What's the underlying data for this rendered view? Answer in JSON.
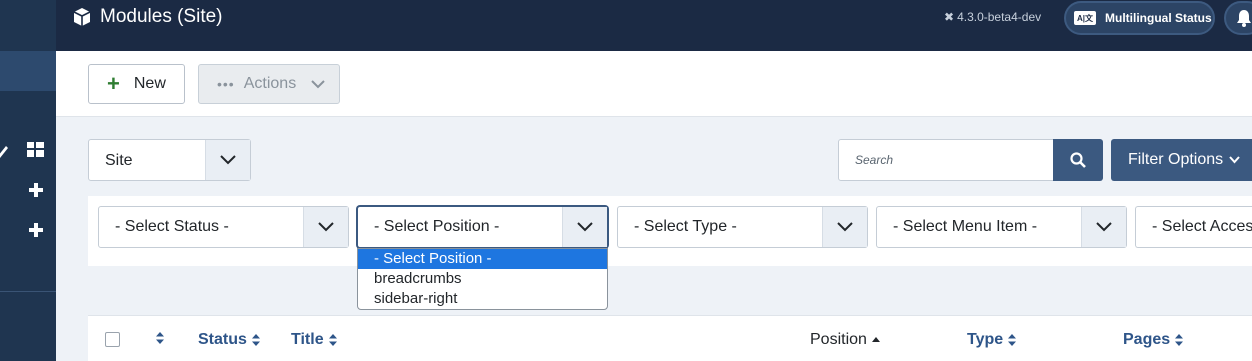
{
  "header": {
    "title": "Modules (Site)",
    "version": "4.3.0-beta4-dev",
    "multilingual_label": "Multilingual Status",
    "lang_icon_text": "A|文"
  },
  "sidebar": {
    "icons": [
      "pencil-icon",
      "dashboard-grid-icon",
      "plus-icon",
      "plus-icon"
    ]
  },
  "toolbar": {
    "new_label": "New",
    "actions_label": "Actions"
  },
  "filters": {
    "client_select_value": "Site",
    "search_placeholder": "Search",
    "filter_options_label": "Filter Options",
    "status": "- Select Status -",
    "position": "- Select Position -",
    "type": "- Select Type -",
    "menu_item": "- Select Menu Item -",
    "access": "- Select Access -"
  },
  "position_dropdown": {
    "options": [
      "- Select Position -",
      "breadcrumbs",
      "sidebar-right"
    ],
    "selected_index": 0
  },
  "table": {
    "columns": {
      "status": "Status",
      "title": "Title",
      "position": "Position",
      "type": "Type",
      "pages": "Pages"
    }
  },
  "colors": {
    "header_bg": "#1b2a44",
    "sidebar_bg": "#1f3550",
    "primary": "#3b5980",
    "link": "#2e5589",
    "dropdown_highlight": "#1e76e0"
  }
}
